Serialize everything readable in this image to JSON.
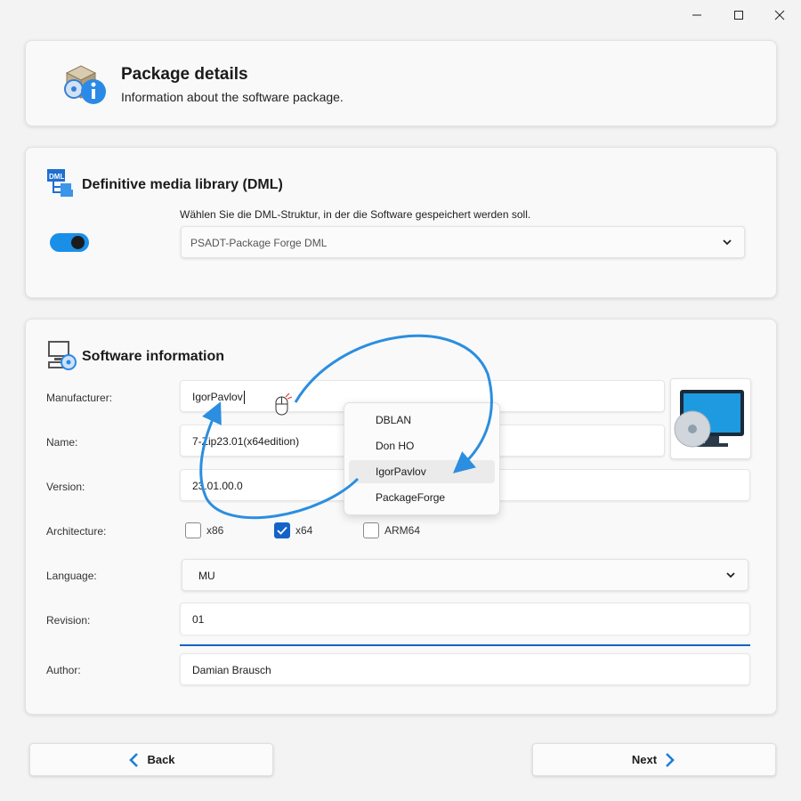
{
  "window": {
    "minimize_glyph": "—",
    "maximize_glyph": "☐",
    "close_glyph": "✕"
  },
  "header": {
    "title": "Package details",
    "subtitle": "Information about the software package."
  },
  "dml": {
    "title": "Definitive media library (DML)",
    "hint": "Wählen Sie die DML-Struktur, in der die Software gespeichert werden soll.",
    "selected": "PSADT-Package Forge DML",
    "toggle_on": true
  },
  "software": {
    "title": "Software information",
    "manufacturer_label": "Manufacturer:",
    "manufacturer_value": "IgorPavlov",
    "name_label": "Name:",
    "name_value": "7-Zip23.01(x64edition)",
    "version_label": "Version:",
    "version_value": "23.01.00.0",
    "architecture_label": "Architecture:",
    "arch": [
      {
        "label": "x86",
        "checked": false
      },
      {
        "label": "x64",
        "checked": true
      },
      {
        "label": "ARM64",
        "checked": false
      }
    ],
    "language_label": "Language:",
    "language_value": "MU",
    "revision_label": "Revision:",
    "revision_value": "01",
    "author_label": "Author:",
    "author_value": "Damian Brausch"
  },
  "autocomplete": {
    "items": [
      "DBLAN",
      "Don HO",
      "IgorPavlov",
      "PackageForge"
    ],
    "selected_index": 2
  },
  "footer": {
    "back_label": "Back",
    "next_label": "Next"
  },
  "colors": {
    "accent": "#1464c8",
    "arrow": "#2b8ee0",
    "toggle": "#1a8fe8"
  }
}
